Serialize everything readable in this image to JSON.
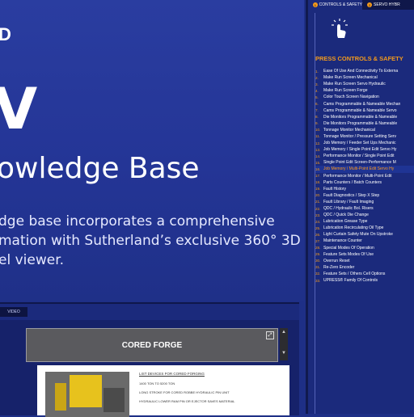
{
  "hero": {
    "brand_fragment": "D",
    "big_letter": "V",
    "title": "owledge Base",
    "description_lines": [
      "dge base incorporates a comprehensive",
      "mation with Sutherland’s exclusive 360° 3D",
      "el viewer."
    ]
  },
  "panel": {
    "tabs": [
      {
        "num": "1",
        "label": "CONTROLS & SAFETY"
      },
      {
        "num": "2",
        "label": "SERVO HYBR"
      }
    ],
    "heading": "PRESS CONTROLS & SAFETY",
    "items": [
      {
        "n": "1.",
        "label": "Ease Of Use And Connectivity To Externa"
      },
      {
        "n": "2.",
        "label": "Make Run Screen Mechanical"
      },
      {
        "n": "3.",
        "label": "Make Run Screen Servo Hydraulic"
      },
      {
        "n": "4.",
        "label": "Make Run Screen Forge"
      },
      {
        "n": "5.",
        "label": "Color Touch Screen Navigation"
      },
      {
        "n": "6.",
        "label": "Cams Programmable & Nameable Mechan"
      },
      {
        "n": "7.",
        "label": "Cams Programmable & Nameable Servo"
      },
      {
        "n": "8.",
        "label": "Die Monitors Programmable & Nameable"
      },
      {
        "n": "9.",
        "label": "Die Monitors Programmable & Nameable"
      },
      {
        "n": "10.",
        "label": "Tonnage Monitor Mechanical"
      },
      {
        "n": "11.",
        "label": "Tonnage Monitor / Pressure Setting Serv"
      },
      {
        "n": "12.",
        "label": "Job Memory / Feeder Set Ups Mechanic"
      },
      {
        "n": "13.",
        "label": "Job Memory / Single Point Edit Servo Hy"
      },
      {
        "n": "14.",
        "label": "Performance Monitor / Single Point Edit"
      },
      {
        "n": "15.",
        "label": "Single Point Edit Screen-Performance M"
      },
      {
        "n": "16.",
        "label": "Job Memory / Multi-Point Edit Servo Hy"
      },
      {
        "n": "17.",
        "label": "Performance Monitor / Multi-Point Edit"
      },
      {
        "n": "18.",
        "label": "Parts Counters / Batch Counters"
      },
      {
        "n": "19.",
        "label": "Fault History"
      },
      {
        "n": "20.",
        "label": "Fault Diagnostics / Step X Step"
      },
      {
        "n": "21.",
        "label": "Fault Library / Fault Imaging"
      },
      {
        "n": "22.",
        "label": "QDC / Hydraulic Bol. Risers"
      },
      {
        "n": "23.",
        "label": "QDC / Quick Die Change"
      },
      {
        "n": "24.",
        "label": "Lubrication Grease Type"
      },
      {
        "n": "25.",
        "label": "Lubrication Recirculating Oil Type"
      },
      {
        "n": "26.",
        "label": "Light Curtain Safety Mute On Upstroke"
      },
      {
        "n": "27.",
        "label": "Maintenance Counter"
      },
      {
        "n": "28.",
        "label": "Special Modes Of Operation"
      },
      {
        "n": "29.",
        "label": "Feature Sets Modes Of Use"
      },
      {
        "n": "30.",
        "label": "Overrun Reset"
      },
      {
        "n": "31.",
        "label": "Re-Zero Encoder"
      },
      {
        "n": "32.",
        "label": "Feature Sets / Others Cell Options"
      },
      {
        "n": "33.",
        "label": "UPRESS® Family Of Controls"
      }
    ],
    "highlight_index": 15
  },
  "viewer": {
    "tab_label": "VIDEO",
    "card_title": "CORED FORGE",
    "doc_heading": "LIST DEVICES FOR CORED FORGING",
    "doc_bullets": [
      "1400 TON TO 5200 TON",
      "LONG STROKE FOR CORED ROBBE HYDRAULIC PIN UNIT",
      "HYDRAULIC LOWER RAM PIN OR EJECTOR SAVES MATERIAL"
    ]
  }
}
